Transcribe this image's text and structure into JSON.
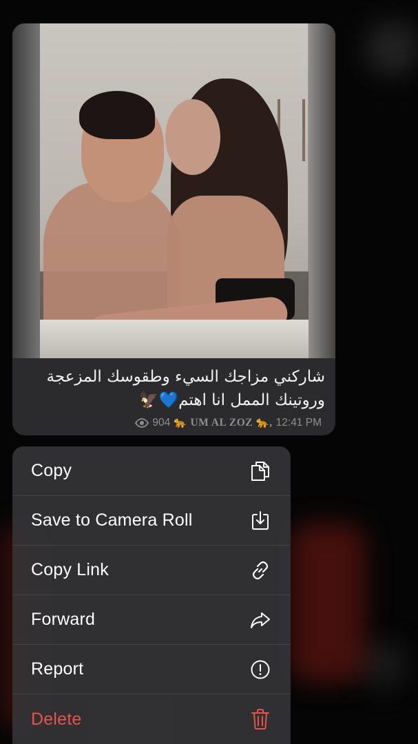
{
  "message": {
    "caption": "شاركني مزاجك السيء وطقوسك المزعجة وروتينك الممل انا اهتم💙🦅",
    "views": "904",
    "signature": "🐆 UM AL ZOZ 🐆,",
    "time": "12:41 PM",
    "icons": {
      "views": "eye-icon"
    }
  },
  "menu": {
    "items": [
      {
        "label": "Copy",
        "icon": "copy-icon"
      },
      {
        "label": "Save to Camera Roll",
        "icon": "download-icon"
      },
      {
        "label": "Copy Link",
        "icon": "link-icon"
      },
      {
        "label": "Forward",
        "icon": "forward-icon"
      },
      {
        "label": "Report",
        "icon": "report-icon"
      },
      {
        "label": "Delete",
        "icon": "trash-icon"
      }
    ],
    "colors": {
      "normal": "#ffffff",
      "destructive": "#e6544a"
    }
  }
}
